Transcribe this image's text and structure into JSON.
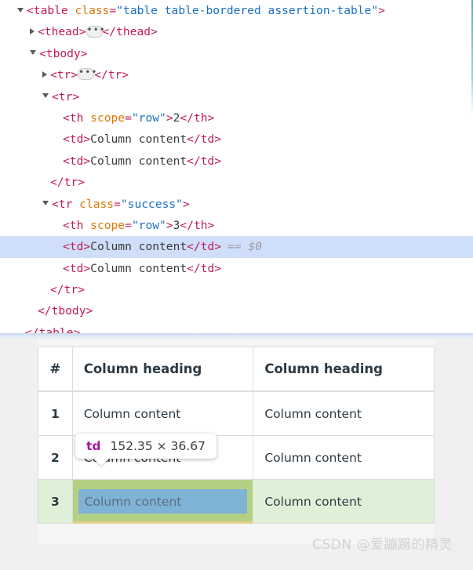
{
  "devtools": {
    "panel_name": "elements-dom-tree",
    "lines": [
      {
        "indent": 0,
        "twisty": "open",
        "parts": [
          {
            "t": "tag",
            "s": "<table "
          },
          {
            "t": "attr",
            "s": "class"
          },
          {
            "t": "tag",
            "s": "="
          },
          {
            "t": "val",
            "s": "\"table table-bordered assertion-table\""
          },
          {
            "t": "tag",
            "s": ">"
          }
        ]
      },
      {
        "indent": 1,
        "twisty": "closed",
        "badge": true,
        "parts": [
          {
            "t": "tag",
            "s": "<thead>"
          },
          {
            "t": "badge",
            "s": "…"
          },
          {
            "t": "tag",
            "s": "</thead>"
          }
        ]
      },
      {
        "indent": 1,
        "twisty": "open",
        "parts": [
          {
            "t": "tag",
            "s": "<tbody>"
          }
        ]
      },
      {
        "indent": 2,
        "twisty": "closed",
        "badge": true,
        "parts": [
          {
            "t": "tag",
            "s": "<tr>"
          },
          {
            "t": "badge",
            "s": "…"
          },
          {
            "t": "tag",
            "s": "</tr>"
          }
        ]
      },
      {
        "indent": 2,
        "twisty": "open",
        "parts": [
          {
            "t": "tag",
            "s": "<tr>"
          }
        ]
      },
      {
        "indent": 3,
        "twisty": "none",
        "parts": [
          {
            "t": "tag",
            "s": "<th "
          },
          {
            "t": "attr",
            "s": "scope"
          },
          {
            "t": "tag",
            "s": "="
          },
          {
            "t": "val",
            "s": "\"row\""
          },
          {
            "t": "tag",
            "s": ">"
          },
          {
            "t": "txt",
            "s": "2"
          },
          {
            "t": "tag",
            "s": "</th>"
          }
        ]
      },
      {
        "indent": 3,
        "twisty": "none",
        "parts": [
          {
            "t": "tag",
            "s": "<td>"
          },
          {
            "t": "txt",
            "s": "Column content"
          },
          {
            "t": "tag",
            "s": "</td>"
          }
        ]
      },
      {
        "indent": 3,
        "twisty": "none",
        "parts": [
          {
            "t": "tag",
            "s": "<td>"
          },
          {
            "t": "txt",
            "s": "Column content"
          },
          {
            "t": "tag",
            "s": "</td>"
          }
        ]
      },
      {
        "indent": 2,
        "twisty": "none",
        "parts": [
          {
            "t": "tag",
            "s": "</tr>"
          }
        ]
      },
      {
        "indent": 2,
        "twisty": "open",
        "parts": [
          {
            "t": "tag",
            "s": "<tr "
          },
          {
            "t": "attr",
            "s": "class"
          },
          {
            "t": "tag",
            "s": "="
          },
          {
            "t": "val",
            "s": "\"success\""
          },
          {
            "t": "tag",
            "s": ">"
          }
        ]
      },
      {
        "indent": 3,
        "twisty": "none",
        "parts": [
          {
            "t": "tag",
            "s": "<th "
          },
          {
            "t": "attr",
            "s": "scope"
          },
          {
            "t": "tag",
            "s": "="
          },
          {
            "t": "val",
            "s": "\"row\""
          },
          {
            "t": "tag",
            "s": ">"
          },
          {
            "t": "txt",
            "s": "3"
          },
          {
            "t": "tag",
            "s": "</th>"
          }
        ]
      },
      {
        "indent": 3,
        "twisty": "none",
        "selected": true,
        "parts": [
          {
            "t": "tag",
            "s": "<td>"
          },
          {
            "t": "txt",
            "s": "Column content"
          },
          {
            "t": "tag",
            "s": "</td>"
          },
          {
            "t": "ref",
            "s": "== $0"
          }
        ]
      },
      {
        "indent": 3,
        "twisty": "none",
        "parts": [
          {
            "t": "tag",
            "s": "<td>"
          },
          {
            "t": "txt",
            "s": "Column content"
          },
          {
            "t": "tag",
            "s": "</td>"
          }
        ]
      },
      {
        "indent": 2,
        "twisty": "none",
        "parts": [
          {
            "t": "tag",
            "s": "</tr>"
          }
        ]
      },
      {
        "indent": 1,
        "twisty": "none",
        "parts": [
          {
            "t": "tag",
            "s": "</tbody>"
          }
        ]
      },
      {
        "indent": 0,
        "twisty": "none",
        "parts": [
          {
            "t": "tag",
            "s": "</table>"
          }
        ]
      }
    ]
  },
  "rendered_table": {
    "headers": [
      "#",
      "Column heading",
      "Column heading"
    ],
    "rows": [
      {
        "num": "1",
        "c2": "Column content",
        "c3": "Column content",
        "state": "default"
      },
      {
        "num": "2",
        "c2": "Column content",
        "c3": "Column content",
        "state": "default"
      },
      {
        "num": "3",
        "c2": "Column content",
        "c3": "Column content",
        "state": "success"
      }
    ]
  },
  "tooltip": {
    "tag": "td",
    "dimensions": "152.35 × 36.67"
  },
  "watermark": {
    "text": "CSDN @爱蹦蹶的精灵"
  },
  "colors": {
    "tag": "#c41a56",
    "attr_name": "#d97706",
    "attr_value": "#1a6fc4",
    "text_node": "#3b3b3b",
    "selected_row": "#cfdefa",
    "console_ref": "#9b9b9b",
    "success_row": "#dff0d8",
    "highlight_content": "#7fb3d5",
    "highlight_padding": "#b3d084",
    "highlight_margin": "#e8cf8a",
    "tooltip_tag": "#a0189b",
    "page_background": "#f0f0f0",
    "table_border": "#dddddd"
  }
}
